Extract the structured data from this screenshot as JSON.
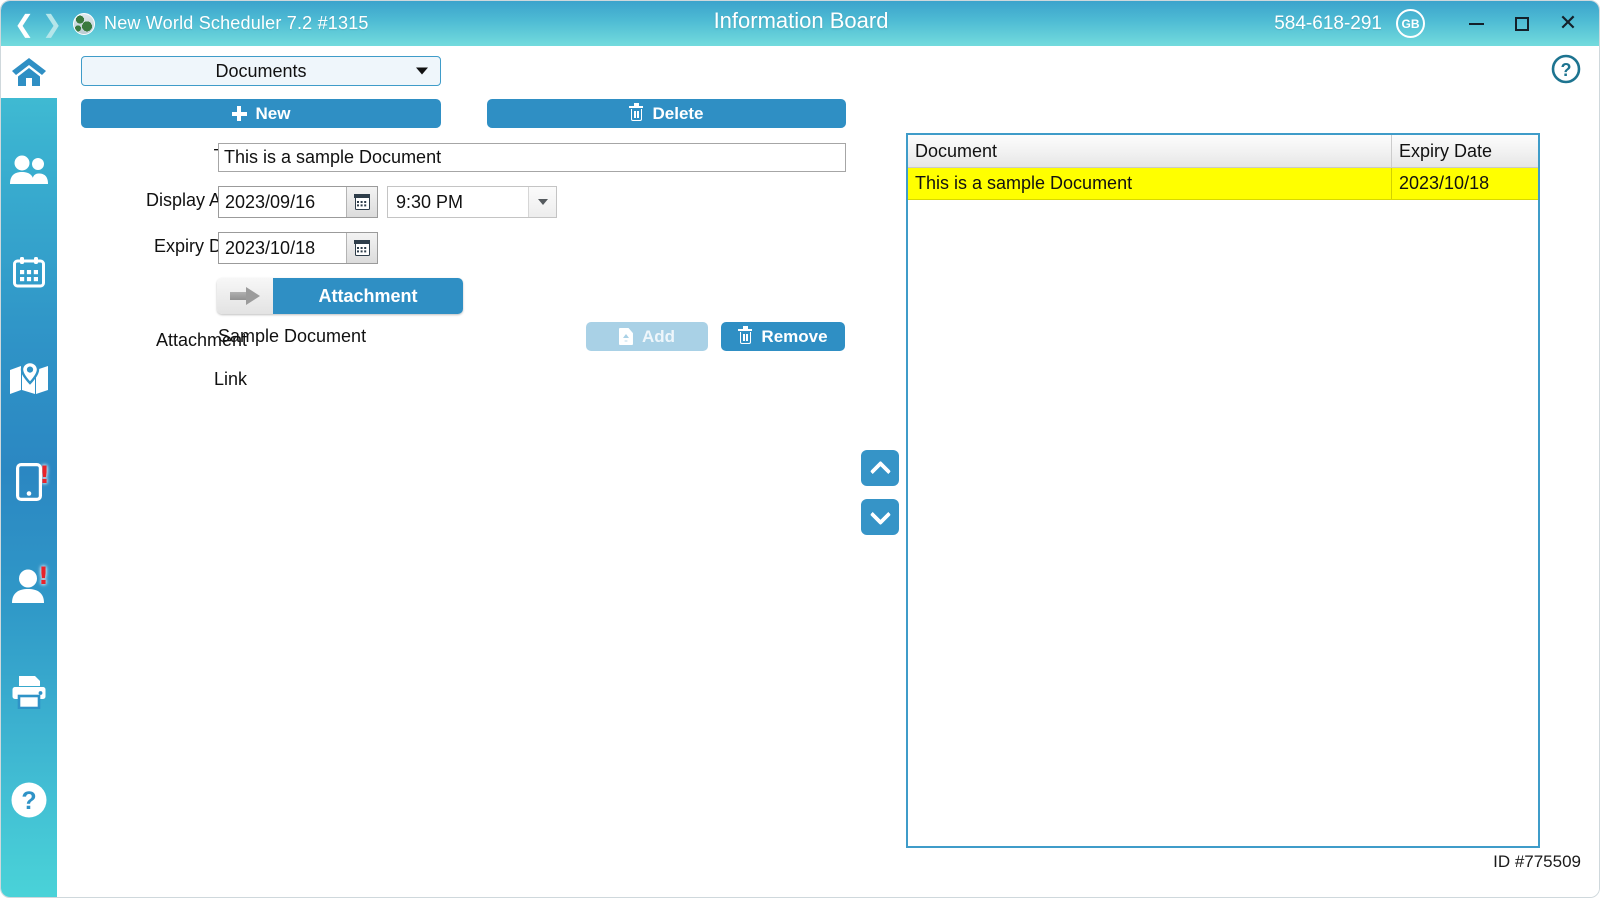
{
  "titlebar": {
    "back_icon": "chevron-left-icon",
    "forward_icon": "chevron-right-icon",
    "globe_icon": "globe-icon",
    "app_title": "New World Scheduler 7.2 #1315",
    "board_title": "Information Board",
    "account_number": "584-618-291",
    "user_badge": "GB",
    "minimize_label": "Minimize",
    "maximize_label": "Maximize",
    "close_label": "Close"
  },
  "sidebar": {
    "items": [
      {
        "name": "home",
        "icon": "home-icon",
        "badge": false
      },
      {
        "name": "people",
        "icon": "people-icon",
        "badge": false
      },
      {
        "name": "calendar",
        "icon": "calendar-icon",
        "badge": false
      },
      {
        "name": "map",
        "icon": "map-pin-icon",
        "badge": true
      },
      {
        "name": "mobile",
        "icon": "mobile-phone-icon",
        "badge": true
      },
      {
        "name": "contact",
        "icon": "person-icon",
        "badge": true
      },
      {
        "name": "print",
        "icon": "printer-icon",
        "badge": false
      },
      {
        "name": "help",
        "icon": "question-circle-icon",
        "badge": false
      }
    ]
  },
  "toolbar": {
    "help_icon": "question-circle-icon",
    "category_value": "Documents",
    "category_caret_icon": "caret-down-icon",
    "new_label": "New",
    "new_icon": "plus-icon",
    "delete_label": "Delete",
    "delete_icon": "trash-icon"
  },
  "form": {
    "title_label": "Title",
    "title_value": "This is a sample Document",
    "display_after_label": "Display After",
    "display_after_date": "2023/09/16",
    "display_after_time": "9:30 PM",
    "calendar_icon": "calendar-icon",
    "time_caret_icon": "caret-down-icon",
    "expiry_date_label": "Expiry Date",
    "expiry_date_value": "2023/10/18",
    "attachment_button_label": "Attachment",
    "attachment_button_icon": "arrow-right-icon",
    "attachment_label": "Attachment",
    "attachment_value": "Sample Document",
    "link_label": "Link",
    "link_value": "",
    "add_label": "Add",
    "add_icon": "file-upload-icon",
    "remove_label": "Remove",
    "remove_icon": "trash-icon"
  },
  "list_nav": {
    "up_icon": "chevron-up-icon",
    "down_icon": "chevron-down-icon"
  },
  "table": {
    "columns": [
      "Document",
      "Expiry Date"
    ],
    "rows": [
      {
        "document": "This is a sample Document",
        "expiry_date": "2023/10/18",
        "selected": true
      }
    ]
  },
  "footer": {
    "record_id": "ID #775509"
  },
  "colors": {
    "accent_blue": "#2f8fc4",
    "titlebar_top": "#3ba3cc",
    "titlebar_bottom": "#73dbdd",
    "sidebar_blue": "#2b87c2",
    "selection_yellow": "#ffff00",
    "badge_red": "#e8232a",
    "disabled_blue": "#a9d1e6"
  }
}
